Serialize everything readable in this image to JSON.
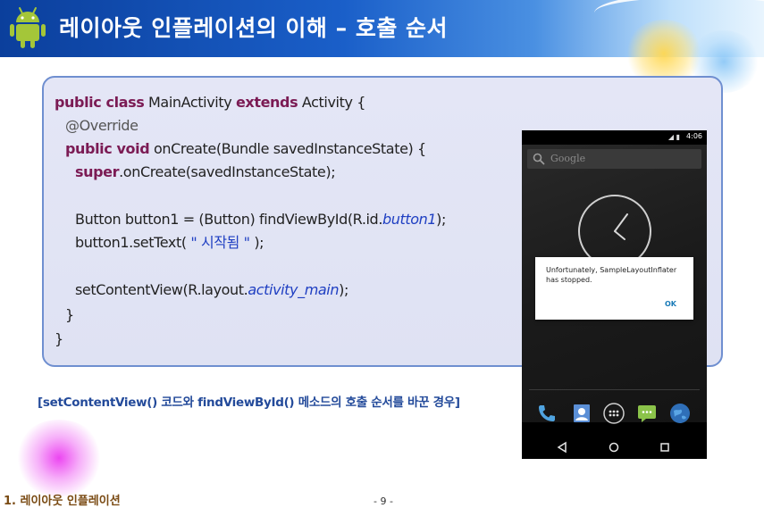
{
  "header": {
    "title": "레이아웃 인플레이션의 이해 – 호출 순서"
  },
  "code": {
    "line1": {
      "kw1": "public class",
      "t1": " MainActivity ",
      "kw2": "extends",
      "t2": " Activity {"
    },
    "line2": {
      "ann": "@Override"
    },
    "line3": {
      "kw1": "public void",
      "t1": " onCreate(Bundle savedInstanceState) {"
    },
    "line4": {
      "kw1": "super",
      "t1": ".onCreate(savedInstanceState);"
    },
    "line5": {
      "t1": "Button button1 = (Button) findViewById(R.id.",
      "fld": "button1",
      "t2": ");"
    },
    "line6": {
      "t1": "button1.setText( ",
      "str": "\" 시작됨 \"",
      "t2": " );"
    },
    "line7": {
      "t1": "setContentView(R.layout.",
      "fld": "activity_main",
      "t2": ");"
    },
    "line8": {
      "t1": "}"
    },
    "line9": {
      "t1": "}"
    }
  },
  "phone": {
    "status_time": "4:06",
    "status_icons": "◢ ▮",
    "search_placeholder": "Google",
    "dialog": {
      "message": "Unfortunately, SampleLayoutInflater has stopped.",
      "ok": "OK"
    },
    "dock_icons": [
      "phone-icon",
      "contacts-icon",
      "apps-icon",
      "messaging-icon",
      "browser-icon"
    ],
    "nav": [
      "back-icon",
      "home-icon",
      "recents-icon"
    ]
  },
  "caption": "[setContentView() 코드와 findViewById() 메소드의 호출 순서를 바꾼 경우]",
  "footer": {
    "section": "1. 레이아웃 인플레이션",
    "page": "- 9 -"
  },
  "colors": {
    "header_blue": "#1a5fc9",
    "keyword": "#7b1b54",
    "field": "#1f3fc2",
    "caption": "#234a9a",
    "footer_section": "#7a4b14",
    "android_green": "#a4c639"
  }
}
